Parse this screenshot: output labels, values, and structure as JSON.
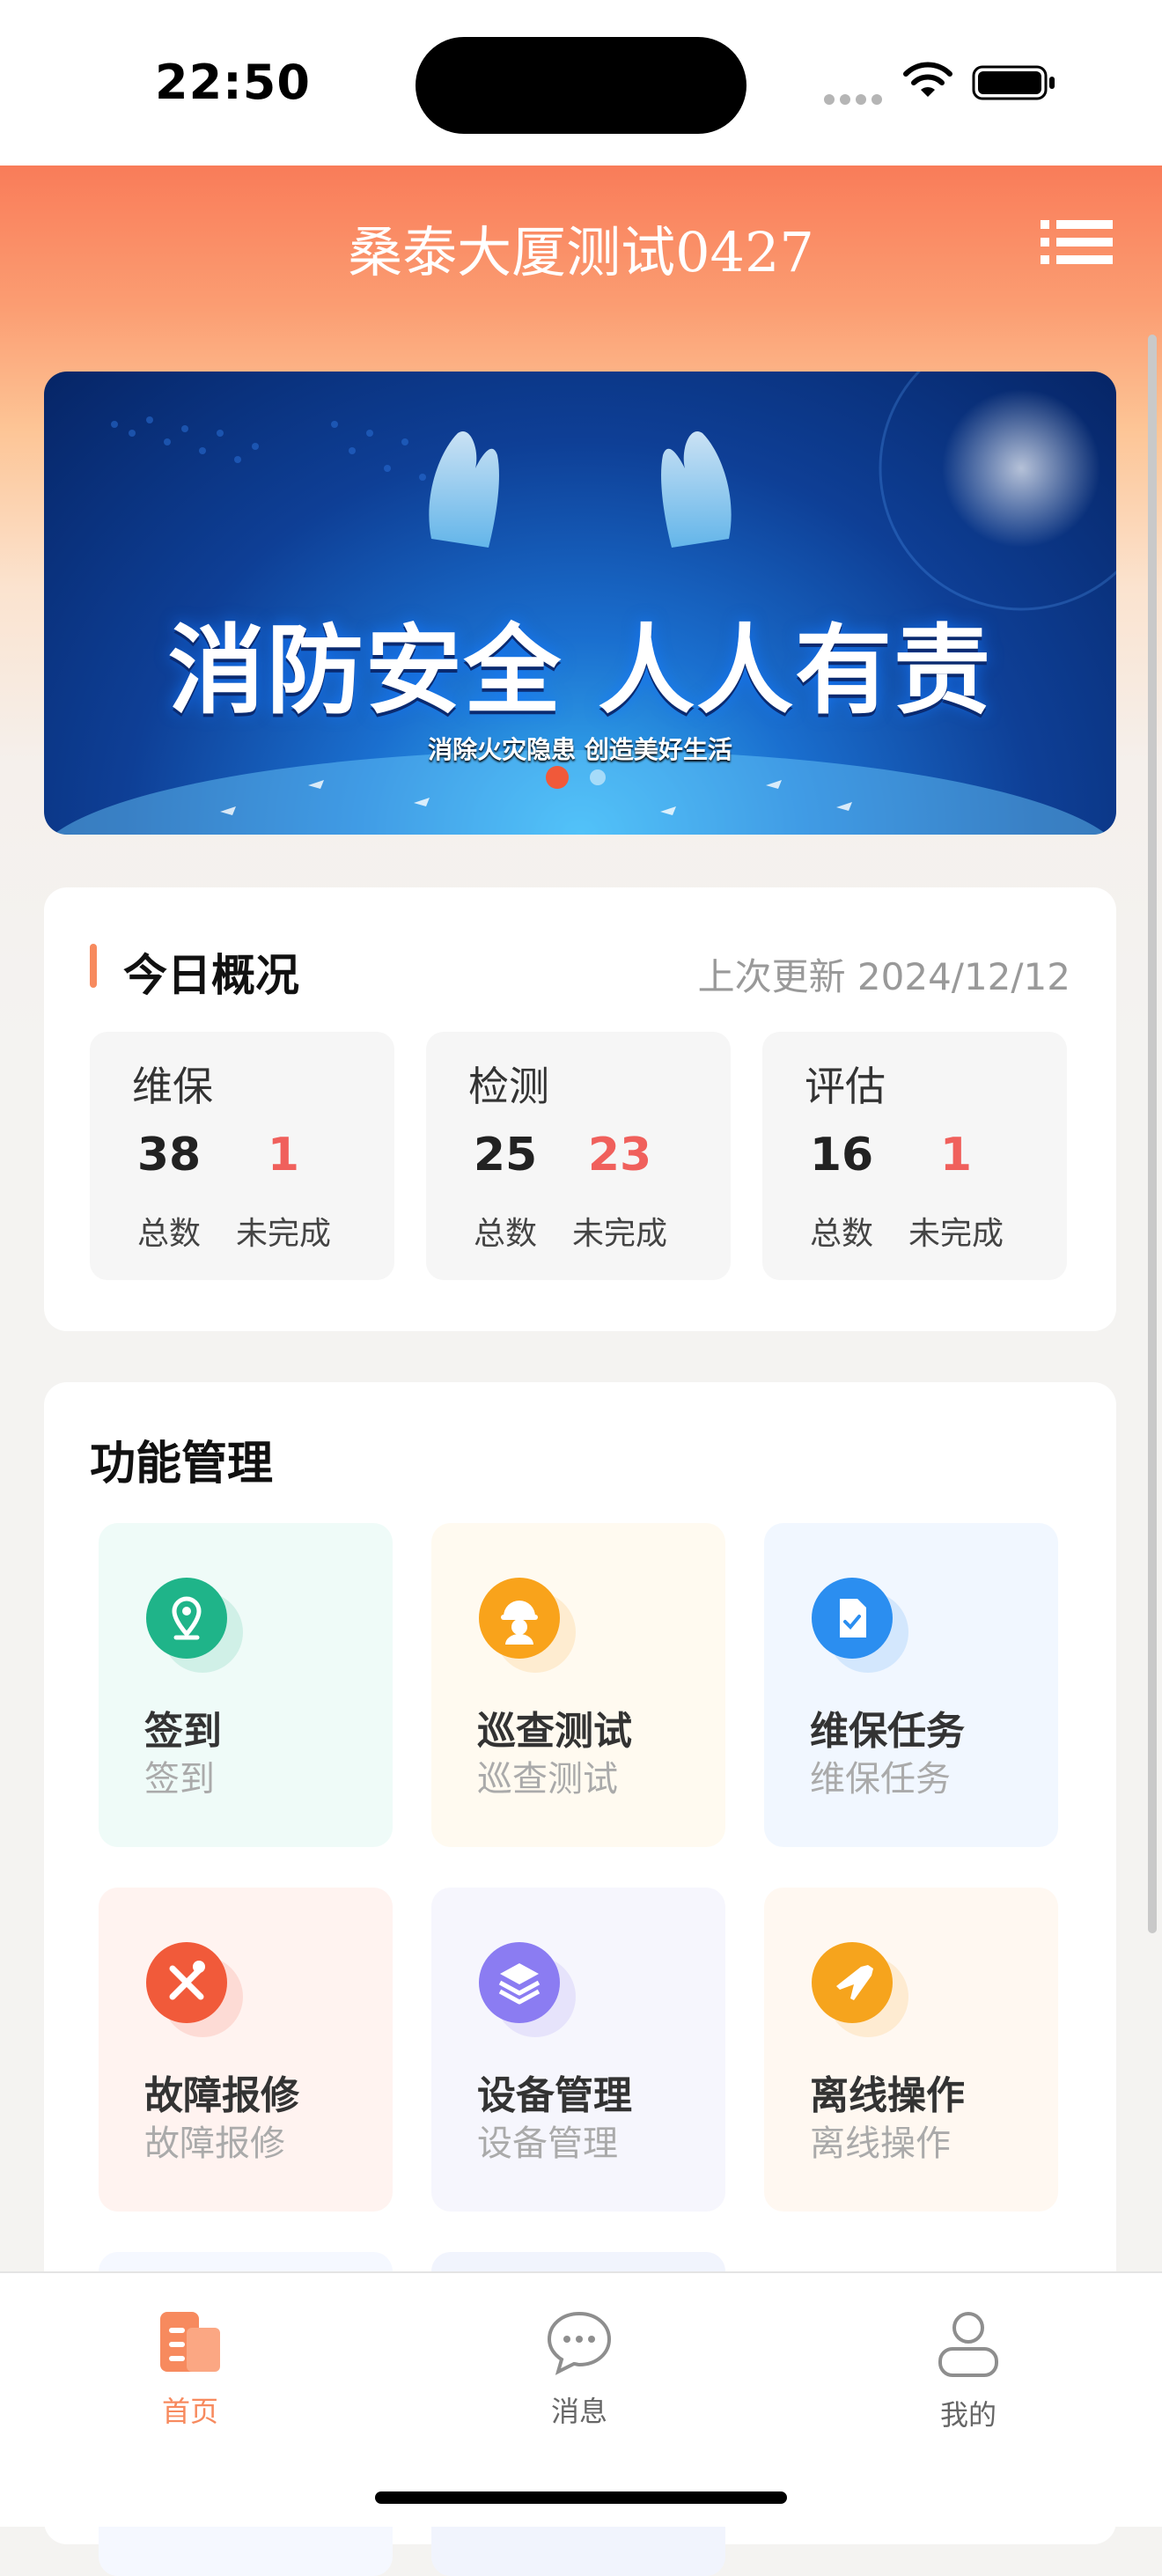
{
  "status_bar": {
    "time": "22:50"
  },
  "header": {
    "title": "桑泰大厦测试0427"
  },
  "banner": {
    "title": "消防安全 人人有责",
    "subtitle": "消除火灾隐患 创造美好生活"
  },
  "overview": {
    "title": "今日概况",
    "last_update": "上次更新 2024/12/12",
    "total_label": "总数",
    "pending_label": "未完成",
    "items": [
      {
        "label": "维保",
        "total": "38",
        "pending": "1"
      },
      {
        "label": "检测",
        "total": "25",
        "pending": "23"
      },
      {
        "label": "评估",
        "total": "16",
        "pending": "1"
      }
    ]
  },
  "features": {
    "title": "功能管理",
    "items": [
      {
        "name": "签到",
        "sub": "签到",
        "icon": "location-pin-icon",
        "color": "#1fb489",
        "bg": "#effbf8"
      },
      {
        "name": "巡查测试",
        "sub": "巡查测试",
        "icon": "worker-helmet-icon",
        "color": "#f9a31b",
        "bg": "#fffaf0"
      },
      {
        "name": "维保任务",
        "sub": "维保任务",
        "icon": "task-document-icon",
        "color": "#2b8ef0",
        "bg": "#f1f7ff"
      },
      {
        "name": "故障报修",
        "sub": "故障报修",
        "icon": "repair-tools-icon",
        "color": "#f15a3a",
        "bg": "#fff3f0"
      },
      {
        "name": "设备管理",
        "sub": "设备管理",
        "icon": "layers-icon",
        "color": "#8b7cf2",
        "bg": "#f6f6fd"
      },
      {
        "name": "离线操作",
        "sub": "离线操作",
        "icon": "airplane-icon",
        "color": "#f6a41d",
        "bg": "#fff8f1"
      }
    ]
  },
  "tabbar": {
    "items": [
      {
        "label": "首页",
        "icon": "home-icon",
        "active": true
      },
      {
        "label": "消息",
        "icon": "message-icon",
        "active": false
      },
      {
        "label": "我的",
        "icon": "profile-icon",
        "active": false
      }
    ],
    "accent": "#f78a5e"
  }
}
